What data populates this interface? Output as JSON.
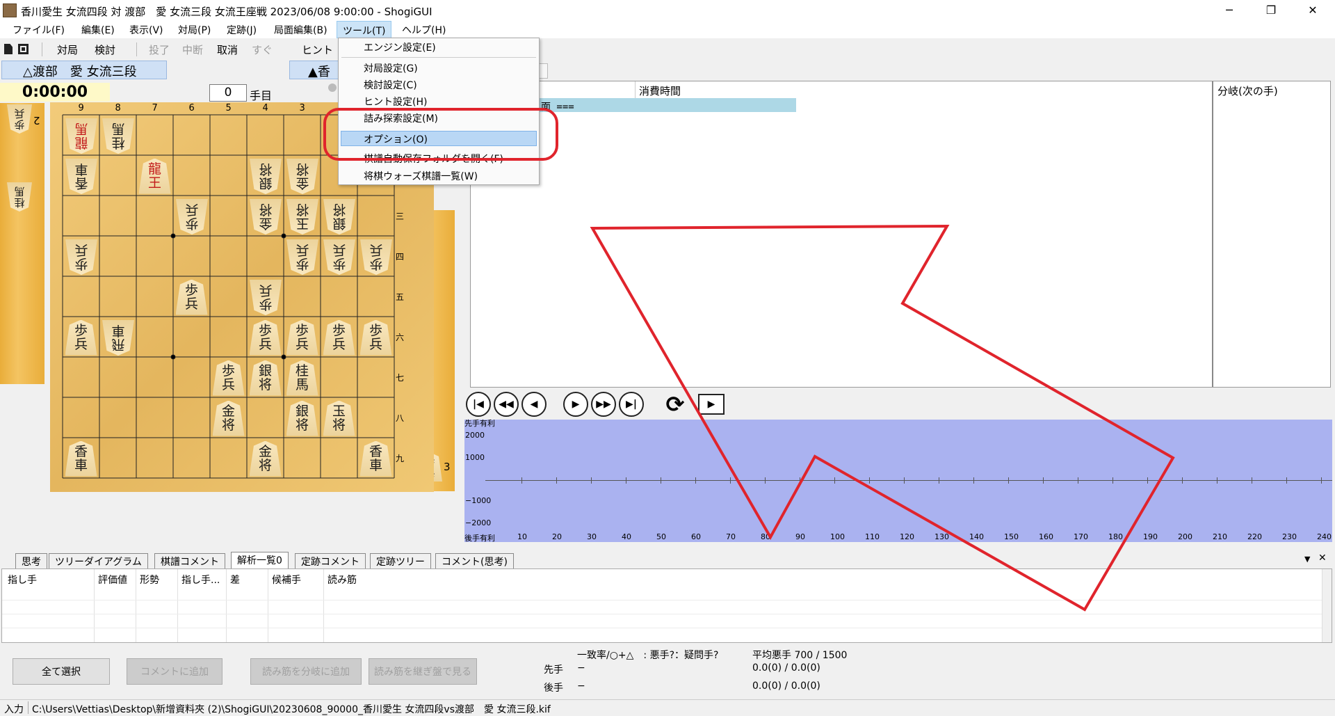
{
  "window": {
    "title": "香川愛生 女流四段 対 渡部　愛 女流三段 女流王座戦 2023/06/08 9:00:00 - ShogiGUI",
    "minimize": "─",
    "maximize": "❐",
    "close": "✕"
  },
  "menu": [
    "ファイル(F)",
    "編集(E)",
    "表示(V)",
    "対局(P)",
    "定跡(J)",
    "局面編集(B)",
    "ツール(T)",
    "ヘルプ(H)"
  ],
  "toolbar": {
    "buttons": [
      "対局",
      "検討",
      "投了",
      "中断",
      "取消",
      "すぐ",
      "ヒント"
    ]
  },
  "players": {
    "gote": "△渡部　愛 女流三段",
    "sente": "▲香"
  },
  "clock": {
    "gote": "0:00:00"
  },
  "move": {
    "number": "0",
    "label": "手目"
  },
  "board": {
    "files": [
      "9",
      "8",
      "7",
      "6",
      "5",
      "4",
      "3"
    ],
    "ranks": [
      "三",
      "四",
      "五",
      "六",
      "七",
      "八",
      "九"
    ],
    "pieces": [
      {
        "text": "龍\n馬",
        "owner": "gote",
        "red": true,
        "file": 9,
        "rank": 1
      },
      {
        "text": "桂\n馬",
        "owner": "gote",
        "file": 8,
        "rank": 1
      },
      {
        "text": "香\n車",
        "owner": "gote",
        "file": 9,
        "rank": 2
      },
      {
        "text": "龍\n王",
        "owner": "sente",
        "red": true,
        "file": 7,
        "rank": 2
      },
      {
        "text": "銀\n将",
        "owner": "gote",
        "file": 4,
        "rank": 2
      },
      {
        "text": "金\n将",
        "owner": "gote",
        "file": 3,
        "rank": 2
      },
      {
        "text": "歩\n兵",
        "owner": "gote",
        "file": 6,
        "rank": 3
      },
      {
        "text": "金\n将",
        "owner": "gote",
        "file": 4,
        "rank": 3
      },
      {
        "text": "玉\n将",
        "owner": "gote",
        "file": 3,
        "rank": 3
      },
      {
        "text": "銀\n将",
        "owner": "gote",
        "file": 2,
        "rank": 3
      },
      {
        "text": "歩\n兵",
        "owner": "gote",
        "file": 9,
        "rank": 4
      },
      {
        "text": "歩\n兵",
        "owner": "gote",
        "file": 3,
        "rank": 4
      },
      {
        "text": "歩\n兵",
        "owner": "gote",
        "file": 2,
        "rank": 4
      },
      {
        "text": "歩\n兵",
        "owner": "gote",
        "file": 1,
        "rank": 4
      },
      {
        "text": "歩\n兵",
        "owner": "sente",
        "file": 6,
        "rank": 5
      },
      {
        "text": "歩\n兵",
        "owner": "gote",
        "file": 4,
        "rank": 5
      },
      {
        "text": "歩\n兵",
        "owner": "sente",
        "file": 9,
        "rank": 6
      },
      {
        "text": "飛\n車",
        "owner": "gote",
        "file": 8,
        "rank": 6
      },
      {
        "text": "歩\n兵",
        "owner": "sente",
        "file": 4,
        "rank": 6
      },
      {
        "text": "歩\n兵",
        "owner": "sente",
        "file": 3,
        "rank": 6
      },
      {
        "text": "歩\n兵",
        "owner": "sente",
        "file": 2,
        "rank": 6
      },
      {
        "text": "歩\n兵",
        "owner": "sente",
        "file": 1,
        "rank": 6
      },
      {
        "text": "歩\n兵",
        "owner": "sente",
        "file": 5,
        "rank": 7
      },
      {
        "text": "銀\n将",
        "owner": "sente",
        "file": 4,
        "rank": 7
      },
      {
        "text": "桂\n馬",
        "owner": "sente",
        "file": 3,
        "rank": 7
      },
      {
        "text": "金\n将",
        "owner": "sente",
        "file": 5,
        "rank": 8
      },
      {
        "text": "銀\n将",
        "owner": "sente",
        "file": 3,
        "rank": 8
      },
      {
        "text": "玉\n将",
        "owner": "sente",
        "file": 2,
        "rank": 8
      },
      {
        "text": "香\n車",
        "owner": "sente",
        "file": 9,
        "rank": 9
      },
      {
        "text": "金\n将",
        "owner": "sente",
        "file": 4,
        "rank": 9
      },
      {
        "text": "香\n車",
        "owner": "sente",
        "file": 1,
        "rank": 9
      }
    ],
    "gote_hand": [
      {
        "text": "歩\n兵",
        "count": "2"
      },
      {
        "text": "桂\n馬",
        "count": ""
      }
    ],
    "sente_hand": [
      {
        "text": "歩\n兵",
        "count": "3"
      }
    ]
  },
  "kifu": {
    "col_time": "消費時間",
    "col_branch": "分岐(次の手)",
    "first_row": "面 ==="
  },
  "graph": {
    "top_label": "先手有利",
    "bottom_label": "後手有利",
    "y_ticks": [
      "2000",
      "1000",
      "−1000",
      "−2000"
    ],
    "x_ticks": [
      "10",
      "20",
      "30",
      "40",
      "50",
      "60",
      "70",
      "80",
      "90",
      "100",
      "110",
      "120",
      "130",
      "140",
      "150",
      "160",
      "170",
      "180",
      "190",
      "200",
      "210",
      "220",
      "230",
      "240"
    ]
  },
  "tabs": [
    "思考",
    "ツリーダイアグラム",
    "棋譜コメント",
    "解析一覧0",
    "定跡コメント",
    "定跡ツリー",
    "コメント(思考)"
  ],
  "analysis": {
    "columns": [
      "指し手",
      "評価値",
      "形勢",
      "指し手...",
      "差",
      "候補手",
      "読み筋"
    ]
  },
  "buttons": {
    "select_all": "全て選択",
    "add_comment": "コメントに追加",
    "add_branch": "読み筋を分岐に追加",
    "continue_board": "読み筋を継ぎ盤で見る"
  },
  "stats": {
    "header": "一致率/○+△　: 悪手?：疑問手?",
    "avg": "平均悪手 700 / 1500",
    "sente_label": "先手",
    "gote_label": "後手",
    "dash": "−",
    "sente_val": "0.0(0) / 0.0(0)",
    "gote_val": "0.0(0) / 0.0(0)"
  },
  "status": {
    "mode": "入力",
    "path": "C:\\Users\\Vettias\\Desktop\\新增資料夾 (2)\\ShogiGUI\\20230608_90000_香川愛生 女流四段vs渡部　愛 女流三段.kif"
  },
  "dropdown": {
    "items": [
      "エンジン設定(E)",
      "対局設定(G)",
      "検討設定(C)",
      "ヒント設定(H)",
      "詰み探索設定(M)",
      "オプション(O)",
      "棋譜自動保存フォルダを開く(F)",
      "将棋ウォーズ棋譜一覧(W)"
    ],
    "highlighted": "オプション(O)"
  },
  "colors": {
    "highlight_ring": "#e0242c",
    "arrow": "#e0242c",
    "graph_bg": "#aab2f0",
    "menu_highlight": "#b9d7f5"
  }
}
